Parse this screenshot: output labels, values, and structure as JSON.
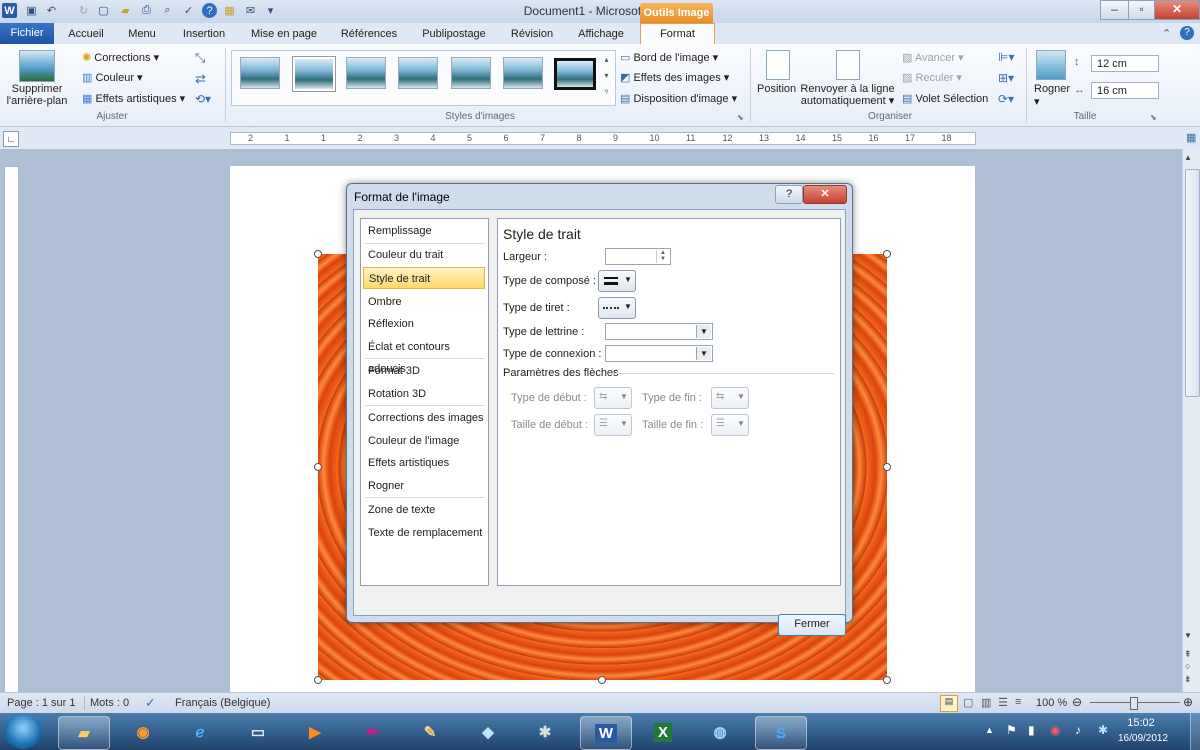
{
  "window": {
    "title": "Document1 - Microsoft Word",
    "contextual_tab": "Outils Image"
  },
  "tabs": [
    "Fichier",
    "Accueil",
    "Menu",
    "Insertion",
    "Mise en page",
    "Références",
    "Publipostage",
    "Révision",
    "Affichage",
    "Format"
  ],
  "ribbon": {
    "ajuster": {
      "label": "Ajuster",
      "remove_bg": [
        "Supprimer",
        "l'arrière-plan"
      ],
      "corrections": "Corrections",
      "couleur": "Couleur",
      "effets": "Effets artistiques"
    },
    "styles": {
      "label": "Styles d'images",
      "bord": "Bord de l'image",
      "effets": "Effets des images",
      "disposition": "Disposition d'image"
    },
    "organiser": {
      "label": "Organiser",
      "position": "Position",
      "renvoyer": [
        "Renvoyer à la ligne",
        "automatiquement"
      ],
      "avancer": "Avancer",
      "reculer": "Reculer",
      "volet": "Volet Sélection"
    },
    "taille": {
      "label": "Taille",
      "rogner": "Rogner",
      "height": "12 cm",
      "width": "16 cm"
    }
  },
  "ruler": {
    "ticks": [
      "2",
      "1",
      "1",
      "2",
      "3",
      "4",
      "5",
      "6",
      "7",
      "8",
      "9",
      "10",
      "11",
      "12",
      "13",
      "14",
      "15",
      "16",
      "17",
      "18"
    ]
  },
  "dialog": {
    "title": "Format de l'image",
    "help": "?",
    "close": "✕",
    "nav": [
      "Remplissage",
      "Couleur du trait",
      "Style de trait",
      "Ombre",
      "Réflexion",
      "Éclat et contours adoucis",
      "Format 3D",
      "Rotation 3D",
      "Corrections des images",
      "Couleur de l'image",
      "Effets artistiques",
      "Rogner",
      "Zone de texte",
      "Texte de remplacement"
    ],
    "active_nav": "Style de trait",
    "panel": {
      "title": "Style de trait",
      "largeur": "Largeur :",
      "type_compose": "Type de composé :",
      "type_tiret": "Type de tiret :",
      "type_lettrine": "Type de lettrine :",
      "type_connexion": "Type de connexion :",
      "arrows_section": "Paramètres des flèches",
      "type_debut": "Type de début :",
      "type_fin": "Type de fin :",
      "taille_debut": "Taille de début :",
      "taille_fin": "Taille de fin :"
    },
    "fermer": "Fermer"
  },
  "status": {
    "page": "Page : 1 sur 1",
    "mots": "Mots : 0",
    "langue": "Français (Belgique)",
    "zoom": "100 %"
  },
  "taskbar": {
    "time": "15:02",
    "date": "16/09/2012",
    "apps": [
      "W",
      "X"
    ]
  },
  "colors": {
    "accent": "#1c54a6",
    "contextual": "#e98c2a",
    "active_nav": "#fbd96a"
  }
}
